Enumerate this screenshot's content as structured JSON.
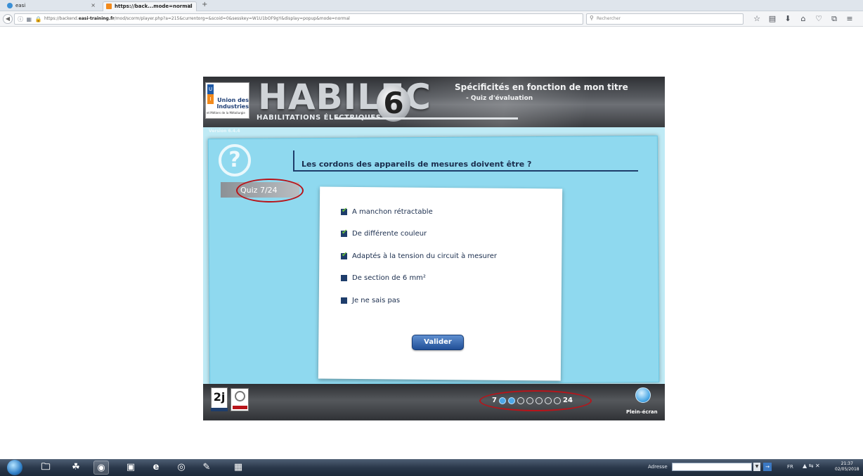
{
  "browser": {
    "tabs": [
      {
        "label": "easi",
        "close": "×"
      },
      {
        "label": "https://back...mode=normal",
        "close": "×"
      }
    ],
    "new_tab": "+",
    "url_prefix": "https://backend.",
    "url_domain": "easi-training.fr",
    "url_rest": "/mod/scorm/player.php?a=215&currentorg=&scoid=0&sesskey=W1U1bOF9gY&display=popup&mode=normal",
    "search_placeholder": "Rechercher"
  },
  "player": {
    "logo_org": "Union des Industries",
    "logo_sub": "et Métiers de la Métallurgie",
    "brand": "HABILEC",
    "brand_number": "6",
    "brand_sub": "HABILITATIONS ÉLECTRIQUES",
    "title": "Spécificités en fonction de mon titre",
    "subtitle": "- Quiz d'évaluation",
    "version": "Version 6.4.4",
    "question": "Les cordons des appareils de mesures doivent être ?",
    "quiz_label": "Quiz 7/24",
    "options": [
      {
        "label": "A manchon rétractable",
        "checked": true
      },
      {
        "label": "De différente couleur",
        "checked": true
      },
      {
        "label": "Adaptés à la tension du circuit à mesurer",
        "checked": true
      },
      {
        "label": "De section de 6 mm²",
        "checked": false
      },
      {
        "label": "Je ne sais pas",
        "checked": false
      }
    ],
    "submit_label": "Valider",
    "footer_logo": "2j",
    "pager_current": "7",
    "pager_total": "24",
    "pager_dots_filled": 2,
    "pager_dots_total": 7,
    "fullscreen_label": "Plein-écran"
  },
  "taskbar": {
    "address_label": "Adresse",
    "lang": "FR",
    "time": "21:37",
    "date": "02/05/2018"
  },
  "colors": {
    "accent_red": "#b8141a",
    "navy": "#1e3d6b",
    "panel_blue": "#8fd9ef",
    "check_green": "#6bbf3a"
  }
}
